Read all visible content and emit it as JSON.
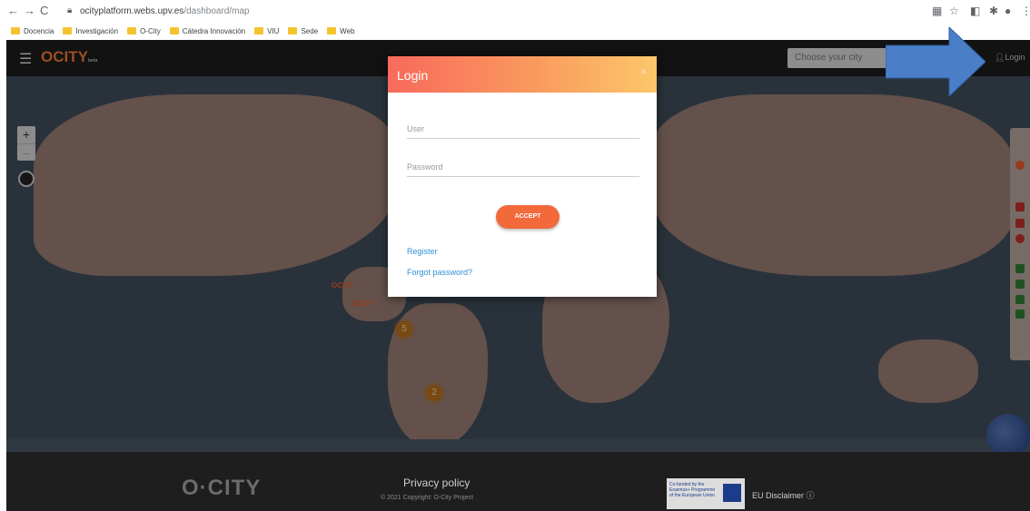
{
  "browser": {
    "url_host": "ocityplatform.webs.upv.es",
    "url_path": "/dashboard/map",
    "bookmarks": [
      "Docencia",
      "Investigación",
      "O-City",
      "Cátedra Innovación",
      "VIU",
      "Sede",
      "Web"
    ]
  },
  "appbar": {
    "logo": "OCITY",
    "logo_sub": "beta",
    "city_placeholder": "Choose your city",
    "login_label": "Login"
  },
  "map": {
    "clusters": [
      "5",
      "2"
    ],
    "marker_label": "OCITY"
  },
  "modal": {
    "title": "Login",
    "close": "×",
    "user_placeholder": "User",
    "password_placeholder": "Password",
    "accept_label": "ACCEPT",
    "register_label": "Register",
    "forgot_label": "Forgot password?"
  },
  "footer": {
    "logo": "O·CITY",
    "privacy": "Privacy policy",
    "copyright": "© 2021 Copyright: O-City Project",
    "eu_text": "Co-funded by the Erasmus+ Programme of the European Union",
    "disclaimer": "EU Disclaimer"
  },
  "colors": {
    "accent": "#f26a3b",
    "modal_gradient_start": "#f86a5c",
    "modal_gradient_end": "#fcc76a",
    "link": "#2f8fd8",
    "arrow": "#4a7fc8"
  }
}
